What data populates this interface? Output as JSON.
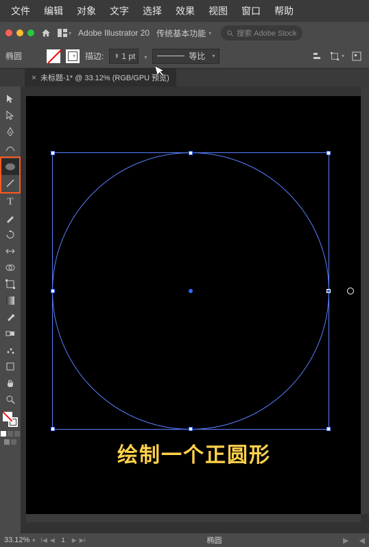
{
  "menubar": [
    "文件",
    "编辑",
    "对象",
    "文字",
    "选择",
    "效果",
    "视图",
    "窗口",
    "帮助"
  ],
  "titlebar": {
    "app_name": "Adobe Illustrator 20",
    "workspace": "传统基本功能",
    "search_placeholder": "搜索 Adobe Stock"
  },
  "controlbar": {
    "selection_label": "椭圆",
    "stroke_label": "描边:",
    "stroke_width": "1 pt",
    "profile_label": "等比"
  },
  "tab": {
    "title": "未标题-1* @ 33.12% (RGB/GPU 预览)"
  },
  "tools": [
    {
      "name": "selection-tool",
      "glyph": "▲"
    },
    {
      "name": "direct-selection-tool",
      "glyph": "▷"
    },
    {
      "name": "pen-tool",
      "glyph": "✒"
    },
    {
      "name": "curvature-tool",
      "glyph": "⌒"
    },
    {
      "name": "ellipse-tool",
      "glyph": "ellipse",
      "highlighted": true,
      "orange_box_group": true
    },
    {
      "name": "line-tool",
      "glyph": "line",
      "orange_box_group": true
    },
    {
      "name": "type-tool",
      "glyph": "T"
    },
    {
      "name": "paintbrush-tool",
      "glyph": "brush"
    },
    {
      "name": "rotate-tool",
      "glyph": "◇"
    },
    {
      "name": "width-tool",
      "glyph": "↔"
    },
    {
      "name": "shape-builder-tool",
      "glyph": "◐"
    },
    {
      "name": "free-transform-tool",
      "glyph": "⛋"
    },
    {
      "name": "gradient-tool",
      "glyph": "grad"
    },
    {
      "name": "eyedropper-tool",
      "glyph": "eyedrop"
    },
    {
      "name": "blend-tool",
      "glyph": "⊙"
    },
    {
      "name": "symbol-sprayer-tool",
      "glyph": "spray"
    },
    {
      "name": "artboard-tool",
      "glyph": "⊞"
    },
    {
      "name": "hand-tool",
      "glyph": "hand"
    },
    {
      "name": "zoom-tool",
      "glyph": "zoom"
    }
  ],
  "caption": "绘制一个正圆形",
  "statusbar": {
    "zoom": "33.12%",
    "artboard_nav": "1",
    "tool_name": "椭圆"
  }
}
